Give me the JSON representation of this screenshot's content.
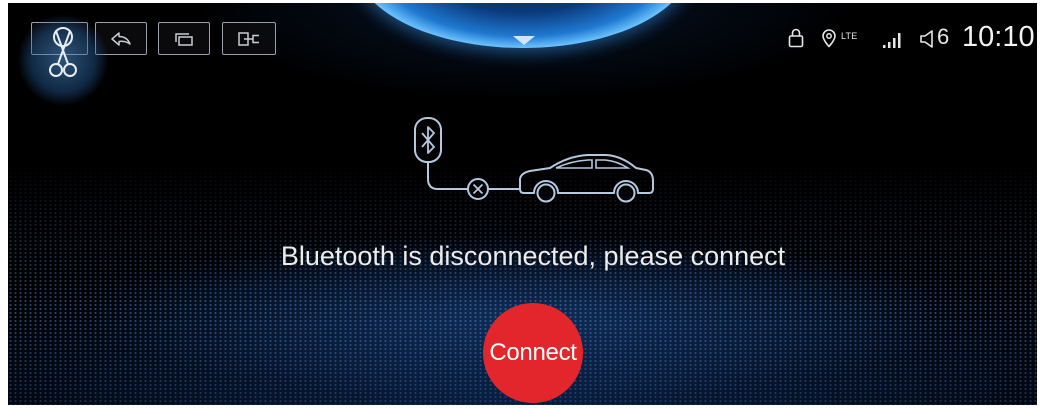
{
  "colors": {
    "screen_bg": "#000000",
    "dome_rim": "#6cc4ff",
    "icon_stroke": "#b5c8de",
    "toolbar_stroke": "#c9cdd2",
    "connect_red": "#e3262b",
    "text": "#ececec"
  },
  "floating_tool": {
    "icon": "screenshot-scissors-icon"
  },
  "toolbar": {
    "buttons": [
      {
        "icon": "person-icon"
      },
      {
        "icon": "back-arrow-icon"
      },
      {
        "icon": "recent-apps-icon"
      },
      {
        "icon": "exit-icon"
      }
    ]
  },
  "control_center": {
    "icon": "chevron-down-icon"
  },
  "status_bar": {
    "lock_icon": "lock-icon",
    "location_icon": "location-pin-icon",
    "network_type": "LTE",
    "signal_icon": "signal-bars-icon",
    "volume_icon": "speaker-icon",
    "volume_level": "6",
    "time": "10:10"
  },
  "bluetooth_panel": {
    "illustration_icons": [
      "bluetooth-icon",
      "disconnected-icon",
      "car-icon"
    ],
    "message": "Bluetooth is disconnected, please connect",
    "connect_label": "Connect"
  }
}
